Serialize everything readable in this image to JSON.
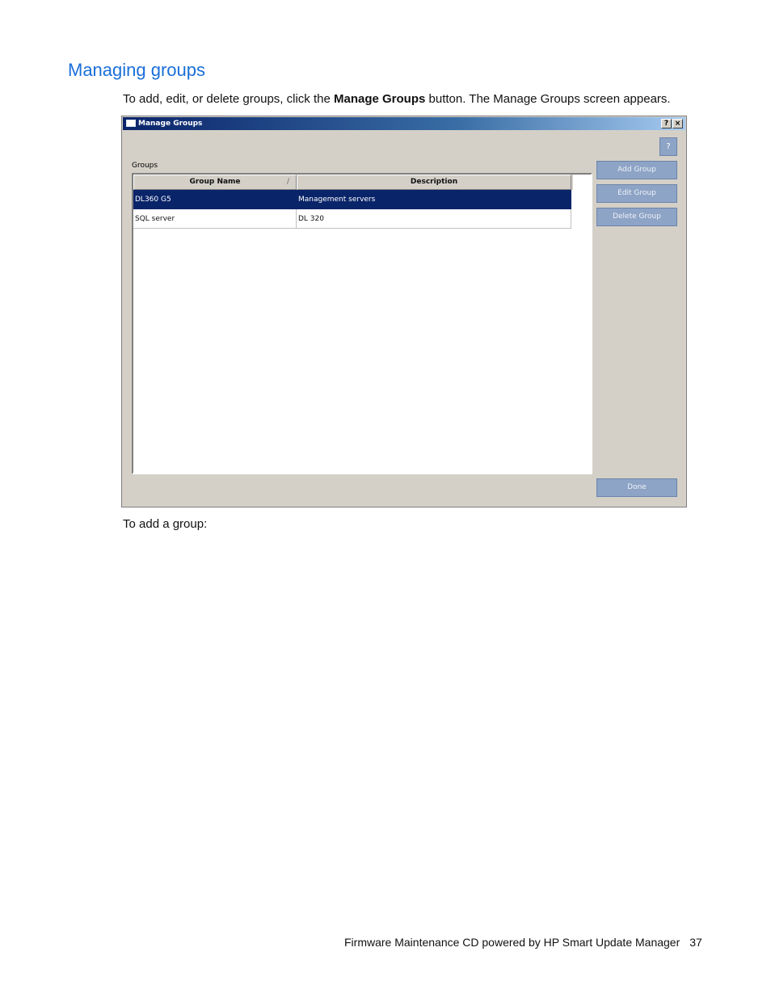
{
  "page": {
    "heading": "Managing groups",
    "intro_before": "To add, edit, or delete groups, click the ",
    "intro_bold": "Manage Groups",
    "intro_after": " button. The Manage Groups screen appears.",
    "after_text": "To add a group:",
    "footer_text": "Firmware Maintenance CD powered by HP Smart Update Manager",
    "page_number": "37"
  },
  "dialog": {
    "title": "Manage Groups",
    "titlebar_help": "?",
    "titlebar_close": "×",
    "help_button": "?",
    "groups_label": "Groups",
    "columns": [
      "Group Name",
      "Description"
    ],
    "sort_indicator": "/",
    "rows": [
      {
        "name": "DL360 G5",
        "description": "Management servers",
        "selected": true
      },
      {
        "name": "SQL server",
        "description": "DL 320",
        "selected": false
      }
    ],
    "buttons": {
      "add": "Add Group",
      "edit": "Edit Group",
      "delete": "Delete Group",
      "done": "Done"
    },
    "colors": {
      "selection": "#0a246a",
      "button": "#8ea4c6",
      "heading": "#1a6fd9"
    }
  }
}
